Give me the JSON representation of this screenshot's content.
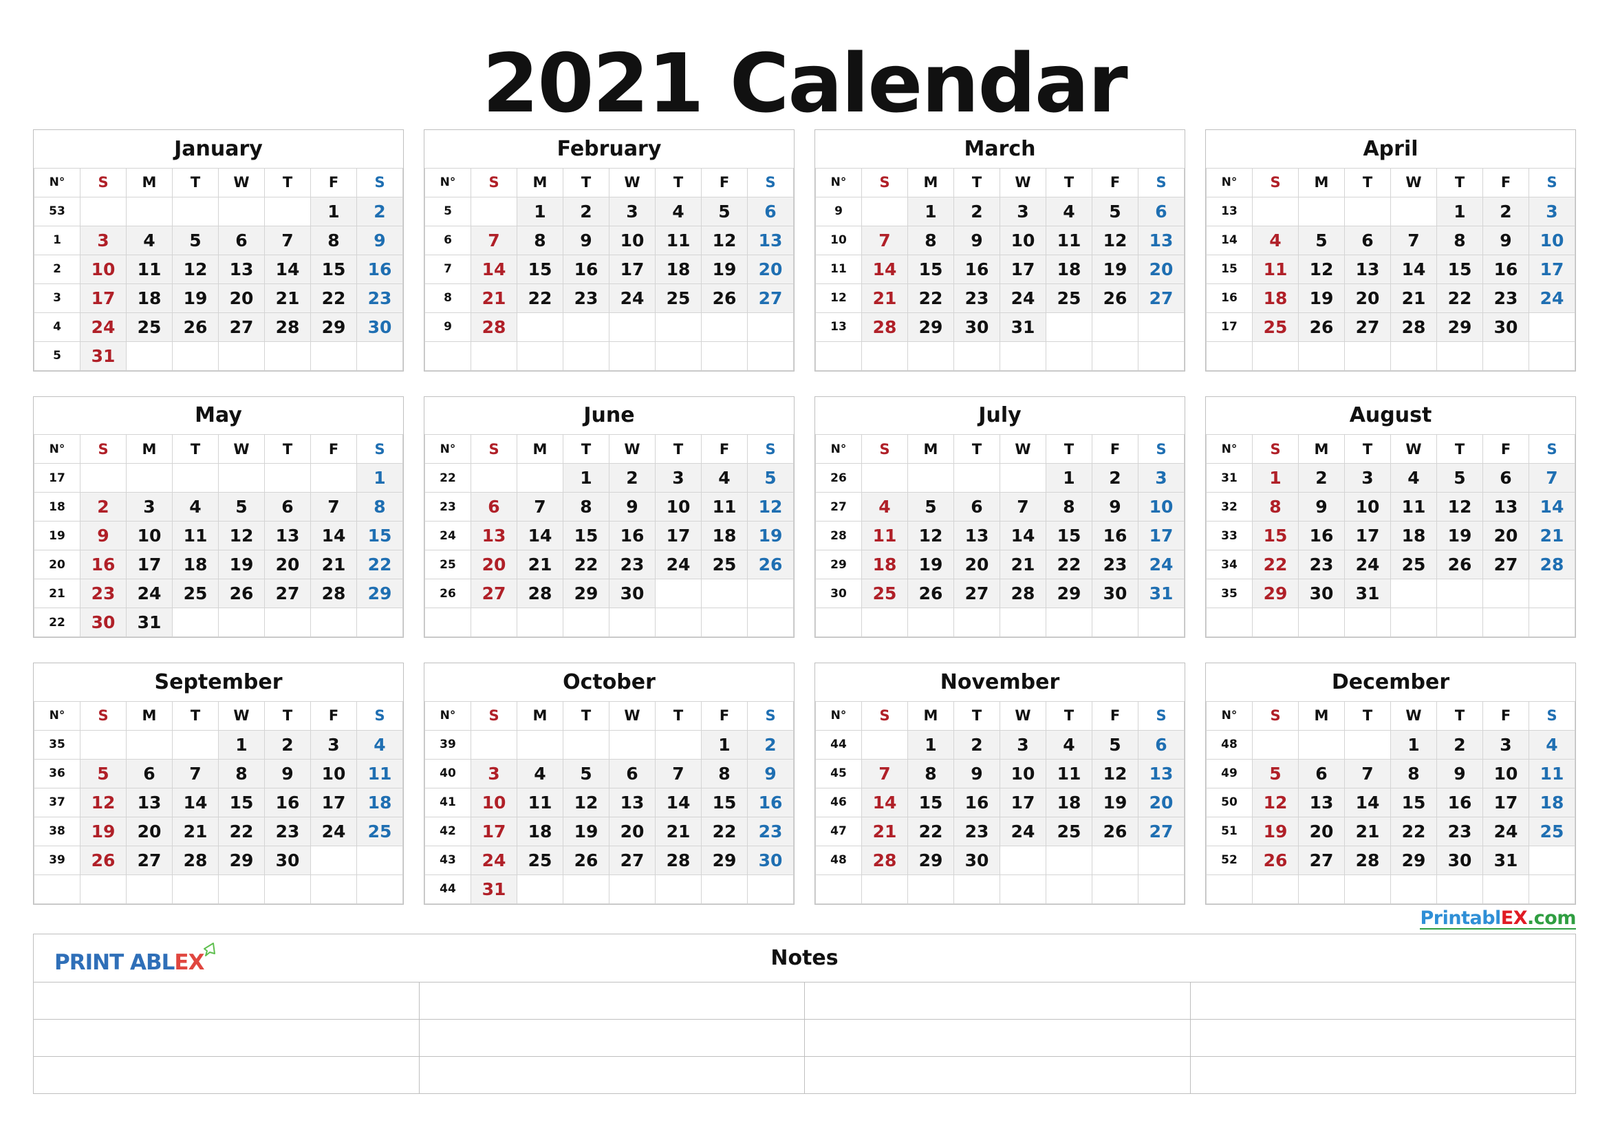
{
  "page": {
    "title": "2021 Calendar",
    "colors": {
      "sunday_red": "#b02028",
      "saturday_blue": "#1f6fb2",
      "day_cell_shade": "#f2f2f2",
      "grid_line": "#d4d4d4",
      "brand_blue": "#2f8fd6",
      "brand_red": "#e01b24",
      "brand_green": "#2f9e41",
      "logo_blue": "#2f6fb8",
      "logo_red": "#e0463f",
      "logo_leaf_green": "#5fbf4f"
    }
  },
  "weekday_headers": {
    "week_number": "N°",
    "sunday": "S",
    "monday": "M",
    "tuesday": "T",
    "wednesday": "W",
    "thursday": "T",
    "friday": "F",
    "saturday": "S"
  },
  "months": [
    {
      "name": "January",
      "weeks": [
        {
          "no": "53",
          "days": [
            "",
            "",
            "",
            "",
            "",
            "1",
            "2"
          ]
        },
        {
          "no": "1",
          "days": [
            "3",
            "4",
            "5",
            "6",
            "7",
            "8",
            "9"
          ]
        },
        {
          "no": "2",
          "days": [
            "10",
            "11",
            "12",
            "13",
            "14",
            "15",
            "16"
          ]
        },
        {
          "no": "3",
          "days": [
            "17",
            "18",
            "19",
            "20",
            "21",
            "22",
            "23"
          ]
        },
        {
          "no": "4",
          "days": [
            "24",
            "25",
            "26",
            "27",
            "28",
            "29",
            "30"
          ]
        },
        {
          "no": "5",
          "days": [
            "31",
            "",
            "",
            "",
            "",
            "",
            ""
          ]
        }
      ]
    },
    {
      "name": "February",
      "weeks": [
        {
          "no": "5",
          "days": [
            "",
            "1",
            "2",
            "3",
            "4",
            "5",
            "6"
          ]
        },
        {
          "no": "6",
          "days": [
            "7",
            "8",
            "9",
            "10",
            "11",
            "12",
            "13"
          ]
        },
        {
          "no": "7",
          "days": [
            "14",
            "15",
            "16",
            "17",
            "18",
            "19",
            "20"
          ]
        },
        {
          "no": "8",
          "days": [
            "21",
            "22",
            "23",
            "24",
            "25",
            "26",
            "27"
          ]
        },
        {
          "no": "9",
          "days": [
            "28",
            "",
            "",
            "",
            "",
            "",
            ""
          ]
        },
        {
          "no": "",
          "days": [
            "",
            "",
            "",
            "",
            "",
            "",
            ""
          ]
        }
      ]
    },
    {
      "name": "March",
      "weeks": [
        {
          "no": "9",
          "days": [
            "",
            "1",
            "2",
            "3",
            "4",
            "5",
            "6"
          ]
        },
        {
          "no": "10",
          "days": [
            "7",
            "8",
            "9",
            "10",
            "11",
            "12",
            "13"
          ]
        },
        {
          "no": "11",
          "days": [
            "14",
            "15",
            "16",
            "17",
            "18",
            "19",
            "20"
          ]
        },
        {
          "no": "12",
          "days": [
            "21",
            "22",
            "23",
            "24",
            "25",
            "26",
            "27"
          ]
        },
        {
          "no": "13",
          "days": [
            "28",
            "29",
            "30",
            "31",
            "",
            "",
            ""
          ]
        },
        {
          "no": "",
          "days": [
            "",
            "",
            "",
            "",
            "",
            "",
            ""
          ]
        }
      ]
    },
    {
      "name": "April",
      "weeks": [
        {
          "no": "13",
          "days": [
            "",
            "",
            "",
            "",
            "1",
            "2",
            "3"
          ]
        },
        {
          "no": "14",
          "days": [
            "4",
            "5",
            "6",
            "7",
            "8",
            "9",
            "10"
          ]
        },
        {
          "no": "15",
          "days": [
            "11",
            "12",
            "13",
            "14",
            "15",
            "16",
            "17"
          ]
        },
        {
          "no": "16",
          "days": [
            "18",
            "19",
            "20",
            "21",
            "22",
            "23",
            "24"
          ]
        },
        {
          "no": "17",
          "days": [
            "25",
            "26",
            "27",
            "28",
            "29",
            "30",
            ""
          ]
        },
        {
          "no": "",
          "days": [
            "",
            "",
            "",
            "",
            "",
            "",
            ""
          ]
        }
      ]
    },
    {
      "name": "May",
      "weeks": [
        {
          "no": "17",
          "days": [
            "",
            "",
            "",
            "",
            "",
            "",
            "1"
          ]
        },
        {
          "no": "18",
          "days": [
            "2",
            "3",
            "4",
            "5",
            "6",
            "7",
            "8"
          ]
        },
        {
          "no": "19",
          "days": [
            "9",
            "10",
            "11",
            "12",
            "13",
            "14",
            "15"
          ]
        },
        {
          "no": "20",
          "days": [
            "16",
            "17",
            "18",
            "19",
            "20",
            "21",
            "22"
          ]
        },
        {
          "no": "21",
          "days": [
            "23",
            "24",
            "25",
            "26",
            "27",
            "28",
            "29"
          ]
        },
        {
          "no": "22",
          "days": [
            "30",
            "31",
            "",
            "",
            "",
            "",
            ""
          ]
        }
      ]
    },
    {
      "name": "June",
      "weeks": [
        {
          "no": "22",
          "days": [
            "",
            "",
            "1",
            "2",
            "3",
            "4",
            "5"
          ]
        },
        {
          "no": "23",
          "days": [
            "6",
            "7",
            "8",
            "9",
            "10",
            "11",
            "12"
          ]
        },
        {
          "no": "24",
          "days": [
            "13",
            "14",
            "15",
            "16",
            "17",
            "18",
            "19"
          ]
        },
        {
          "no": "25",
          "days": [
            "20",
            "21",
            "22",
            "23",
            "24",
            "25",
            "26"
          ]
        },
        {
          "no": "26",
          "days": [
            "27",
            "28",
            "29",
            "30",
            "",
            "",
            ""
          ]
        },
        {
          "no": "",
          "days": [
            "",
            "",
            "",
            "",
            "",
            "",
            ""
          ]
        }
      ]
    },
    {
      "name": "July",
      "weeks": [
        {
          "no": "26",
          "days": [
            "",
            "",
            "",
            "",
            "1",
            "2",
            "3"
          ]
        },
        {
          "no": "27",
          "days": [
            "4",
            "5",
            "6",
            "7",
            "8",
            "9",
            "10"
          ]
        },
        {
          "no": "28",
          "days": [
            "11",
            "12",
            "13",
            "14",
            "15",
            "16",
            "17"
          ]
        },
        {
          "no": "29",
          "days": [
            "18",
            "19",
            "20",
            "21",
            "22",
            "23",
            "24"
          ]
        },
        {
          "no": "30",
          "days": [
            "25",
            "26",
            "27",
            "28",
            "29",
            "30",
            "31"
          ]
        },
        {
          "no": "",
          "days": [
            "",
            "",
            "",
            "",
            "",
            "",
            ""
          ]
        }
      ]
    },
    {
      "name": "August",
      "weeks": [
        {
          "no": "31",
          "days": [
            "1",
            "2",
            "3",
            "4",
            "5",
            "6",
            "7"
          ]
        },
        {
          "no": "32",
          "days": [
            "8",
            "9",
            "10",
            "11",
            "12",
            "13",
            "14"
          ]
        },
        {
          "no": "33",
          "days": [
            "15",
            "16",
            "17",
            "18",
            "19",
            "20",
            "21"
          ]
        },
        {
          "no": "34",
          "days": [
            "22",
            "23",
            "24",
            "25",
            "26",
            "27",
            "28"
          ]
        },
        {
          "no": "35",
          "days": [
            "29",
            "30",
            "31",
            "",
            "",
            "",
            ""
          ]
        },
        {
          "no": "",
          "days": [
            "",
            "",
            "",
            "",
            "",
            "",
            ""
          ]
        }
      ]
    },
    {
      "name": "September",
      "weeks": [
        {
          "no": "35",
          "days": [
            "",
            "",
            "",
            "1",
            "2",
            "3",
            "4"
          ]
        },
        {
          "no": "36",
          "days": [
            "5",
            "6",
            "7",
            "8",
            "9",
            "10",
            "11"
          ]
        },
        {
          "no": "37",
          "days": [
            "12",
            "13",
            "14",
            "15",
            "16",
            "17",
            "18"
          ]
        },
        {
          "no": "38",
          "days": [
            "19",
            "20",
            "21",
            "22",
            "23",
            "24",
            "25"
          ]
        },
        {
          "no": "39",
          "days": [
            "26",
            "27",
            "28",
            "29",
            "30",
            "",
            ""
          ]
        },
        {
          "no": "",
          "days": [
            "",
            "",
            "",
            "",
            "",
            "",
            ""
          ]
        }
      ]
    },
    {
      "name": "October",
      "weeks": [
        {
          "no": "39",
          "days": [
            "",
            "",
            "",
            "",
            "",
            "1",
            "2"
          ]
        },
        {
          "no": "40",
          "days": [
            "3",
            "4",
            "5",
            "6",
            "7",
            "8",
            "9"
          ]
        },
        {
          "no": "41",
          "days": [
            "10",
            "11",
            "12",
            "13",
            "14",
            "15",
            "16"
          ]
        },
        {
          "no": "42",
          "days": [
            "17",
            "18",
            "19",
            "20",
            "21",
            "22",
            "23"
          ]
        },
        {
          "no": "43",
          "days": [
            "24",
            "25",
            "26",
            "27",
            "28",
            "29",
            "30"
          ]
        },
        {
          "no": "44",
          "days": [
            "31",
            "",
            "",
            "",
            "",
            "",
            ""
          ]
        }
      ]
    },
    {
      "name": "November",
      "weeks": [
        {
          "no": "44",
          "days": [
            "",
            "1",
            "2",
            "3",
            "4",
            "5",
            "6"
          ]
        },
        {
          "no": "45",
          "days": [
            "7",
            "8",
            "9",
            "10",
            "11",
            "12",
            "13"
          ]
        },
        {
          "no": "46",
          "days": [
            "14",
            "15",
            "16",
            "17",
            "18",
            "19",
            "20"
          ]
        },
        {
          "no": "47",
          "days": [
            "21",
            "22",
            "23",
            "24",
            "25",
            "26",
            "27"
          ]
        },
        {
          "no": "48",
          "days": [
            "28",
            "29",
            "30",
            "",
            "",
            "",
            ""
          ]
        },
        {
          "no": "",
          "days": [
            "",
            "",
            "",
            "",
            "",
            "",
            ""
          ]
        }
      ]
    },
    {
      "name": "December",
      "weeks": [
        {
          "no": "48",
          "days": [
            "",
            "",
            "",
            "1",
            "2",
            "3",
            "4"
          ]
        },
        {
          "no": "49",
          "days": [
            "5",
            "6",
            "7",
            "8",
            "9",
            "10",
            "11"
          ]
        },
        {
          "no": "50",
          "days": [
            "12",
            "13",
            "14",
            "15",
            "16",
            "17",
            "18"
          ]
        },
        {
          "no": "51",
          "days": [
            "19",
            "20",
            "21",
            "22",
            "23",
            "24",
            "25"
          ]
        },
        {
          "no": "52",
          "days": [
            "26",
            "27",
            "28",
            "29",
            "30",
            "31",
            ""
          ]
        },
        {
          "no": "",
          "days": [
            "",
            "",
            "",
            "",
            "",
            "",
            ""
          ]
        }
      ]
    }
  ],
  "brand_link": {
    "part_blue": "Printabl",
    "part_red": "EX",
    "part_green": ".com"
  },
  "logo": {
    "part_blue": "PRINT ABL",
    "part_red": "EX",
    "corner_icon": "page-corner-icon"
  },
  "notes": {
    "title": "Notes",
    "blank_rows": 3,
    "columns": 4
  }
}
